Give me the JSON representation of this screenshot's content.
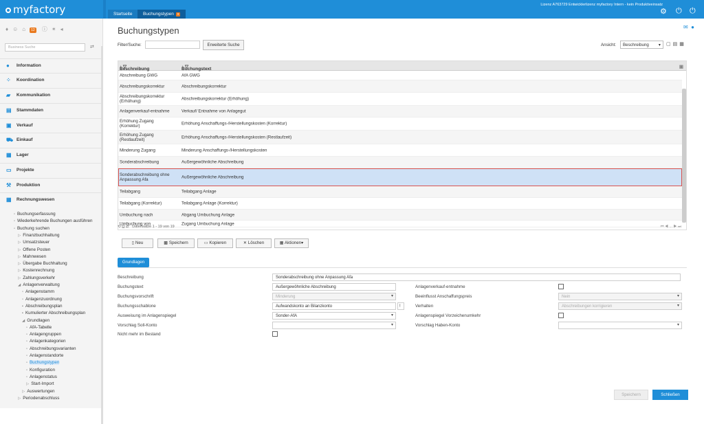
{
  "app": {
    "logo": "myfactory",
    "license": "Lizenz A763729 Entwicklerlizenz myfactory Intern - kein Produktiveinsatz"
  },
  "tabs": [
    {
      "label": "Startseite"
    },
    {
      "label": "Buchungstypen"
    }
  ],
  "tab_close": "x",
  "sidebar": {
    "badge": "12",
    "search_placeholder": "Business Suche",
    "nav": [
      "Information",
      "Koordination",
      "Kommunikation",
      "Stammdaten",
      "Verkauf",
      "Einkauf",
      "Lager",
      "Projekte",
      "Produktion",
      "Rechnungswesen"
    ],
    "tree": [
      {
        "label": "Buchungserfassung",
        "glyph": "▫"
      },
      {
        "label": "Wiederkehrende Buchungen ausführen",
        "glyph": "▫"
      },
      {
        "label": "Buchung suchen",
        "glyph": "▫"
      },
      {
        "label": "Finanzbuchhaltung",
        "glyph": "▷"
      },
      {
        "label": "Umsatzsteuer",
        "glyph": "▷"
      },
      {
        "label": "Offene Posten",
        "glyph": "▷"
      },
      {
        "label": "Mahnwesen",
        "glyph": "▷"
      },
      {
        "label": "Übergabe Buchhaltung",
        "glyph": "▷"
      },
      {
        "label": "Kostenrechnung",
        "glyph": "▷"
      },
      {
        "label": "Zahlungsverkehr",
        "glyph": "▷"
      },
      {
        "label": "Anlagenverwaltung",
        "glyph": "◢"
      },
      {
        "label": "Anlagenstamm",
        "glyph": "▫"
      },
      {
        "label": "Anlagenzuordnung",
        "glyph": "▫"
      },
      {
        "label": "Abschreibungsplan",
        "glyph": "▪"
      },
      {
        "label": "Kumulierter Abschreibungsplan",
        "glyph": "▪"
      },
      {
        "label": "Grundlagen",
        "glyph": "◢"
      },
      {
        "label": "AfA-Tabelle",
        "glyph": "▫"
      },
      {
        "label": "Anlagengruppen",
        "glyph": "▫"
      },
      {
        "label": "Anlagenkategorien",
        "glyph": "▫"
      },
      {
        "label": "Abschreibungsvarianten",
        "glyph": "▫"
      },
      {
        "label": "Anlagenstandorte",
        "glyph": "▫"
      },
      {
        "label": "Buchungstypen",
        "glyph": "▫"
      },
      {
        "label": "Konfiguration",
        "glyph": "▫"
      },
      {
        "label": "Anlagenstatus",
        "glyph": "▫"
      },
      {
        "label": "Start-Import",
        "glyph": "▷"
      },
      {
        "label": "Auswertungen",
        "glyph": "▷"
      },
      {
        "label": "Periodenabschluss",
        "glyph": "▷"
      }
    ]
  },
  "page": {
    "title": "Buchungstypen"
  },
  "filter": {
    "label": "Filter/Suche:",
    "value": "",
    "button": "Erweiterte Suche"
  },
  "view": {
    "label": "Ansicht:",
    "value": "Beschreibung"
  },
  "grid": {
    "columns": [
      "Beschreibung",
      "Buchungstext"
    ],
    "rows": [
      [
        "Abschreibung GWG",
        "AfA GWG"
      ],
      [
        "Abschreibungskorrektur",
        "Abschreibungskorrektur"
      ],
      [
        "Abschreibungskorrektur (Erhöhung)",
        "Abschreibungskorrektur (Erhöhung)"
      ],
      [
        "Anlagenverkauf-entnahme",
        "Verkauf/ Entnahme von Anlagegut"
      ],
      [
        "Erhöhung Zugang (Korrektur)",
        "Erhöhung Anschaffungs-/Herstellungskosten (Korrektur)"
      ],
      [
        "Erhöhung Zugang (Restlaufzeit)",
        "Erhöhung Anschaffungs-/Herstellungskosten (Restlaufzeit)"
      ],
      [
        "Minderung Zugang",
        "Minderung Anschaffungs-/Herstellungskosten"
      ],
      [
        "Sonderabschreibung",
        "Außergewöhnliche Abschreibung"
      ],
      [
        "Sonderabschreibung ohne Anpassung Afa",
        "Außergewöhnliche Abschreibung"
      ],
      [
        "Teilabgang",
        "Teilabgang Anlage"
      ],
      [
        "Teilabgang (Korrektur)",
        "Teilabgang Anlage (Korrektur)"
      ],
      [
        "Umbuchung nach",
        "Abgang Umbuchung Anlage"
      ],
      [
        "Umbuchung von",
        "Zugang Umbuchung Anlage"
      ]
    ],
    "selected_index": 8,
    "footer": "Datensätze 1 - 19 von 19",
    "footer_icons": "⟲ ⎙ ⇄",
    "pager": "⏮ ◀ ... ▶ ⏭"
  },
  "actions": [
    "Neu",
    "Speichern",
    "Kopieren",
    "Löschen",
    "Aktionen▾"
  ],
  "action_icons": [
    "▯",
    "▩",
    "▭",
    "✕",
    "▦"
  ],
  "form": {
    "tab": "Grundlagen",
    "beschreibung": {
      "label": "Beschreibung",
      "value": "Sonderabschreibung ohne Anpassung Afa"
    },
    "buchungstext": {
      "label": "Buchungstext",
      "value": "Außergewöhnliche Abschreibung"
    },
    "buchungsvorschrift": {
      "label": "Buchungsvorschrift",
      "value": "Minderung"
    },
    "buchungsschablone": {
      "label": "Buchungsschablone",
      "value": "Aufwandskonto an Bilanzkonto"
    },
    "ausweisung": {
      "label": "Ausweisung im Anlagenspiegel",
      "value": "Sonder-AfA"
    },
    "soll": {
      "label": "Vorschlag Soll-Konto",
      "value": ""
    },
    "nicht_mehr": {
      "label": "Nicht mehr im Bestand"
    },
    "anlagenverkauf": {
      "label": "Anlagenverkauf-entnahme"
    },
    "beeinflusst": {
      "label": "Beeinflusst Anschaffungspreis",
      "value": "Nein"
    },
    "verhalten": {
      "label": "Verhalten",
      "value": "Abschreibungen korrigieren"
    },
    "vorzeichen": {
      "label": "Anlagenspiegel Vorzeichenumkehr"
    },
    "haben": {
      "label": "Vorschlag Haben-Konto",
      "value": ""
    }
  },
  "footer_buttons": {
    "save": "Speichern",
    "close": "Schließen"
  }
}
